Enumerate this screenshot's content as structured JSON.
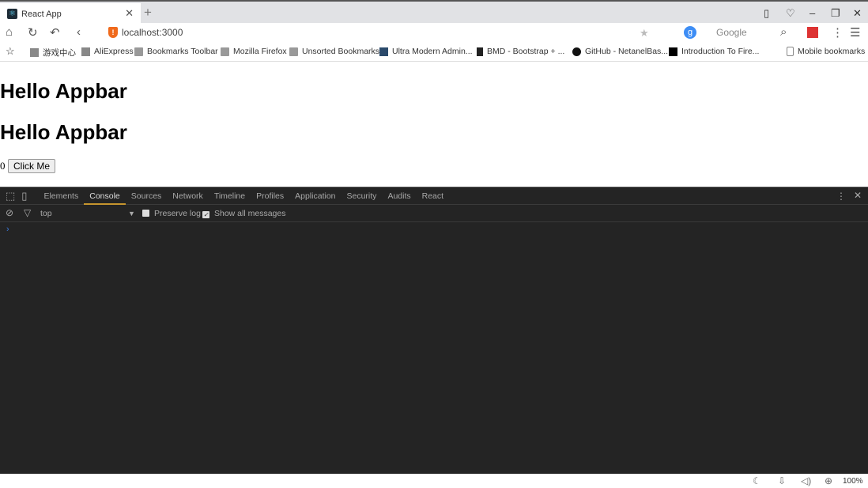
{
  "browser": {
    "tab_title": "React App",
    "url": "localhost:3000",
    "search_engine": "Google",
    "bookmarks": [
      {
        "label": "游戏中心",
        "icon": "page-icon"
      },
      {
        "label": "AliExpress",
        "icon": "page-icon"
      },
      {
        "label": "Bookmarks Toolbar",
        "icon": "folder-icon"
      },
      {
        "label": "Mozilla Firefox",
        "icon": "folder-icon"
      },
      {
        "label": "Unsorted Bookmarks",
        "icon": "folder-icon"
      },
      {
        "label": "Ultra Modern Admin...",
        "icon": "w3-icon"
      },
      {
        "label": "BMD - Bootstrap + ...",
        "icon": "bmd-icon"
      },
      {
        "label": "GitHub - NetanelBas...",
        "icon": "github-icon"
      },
      {
        "label": "Introduction To Fire...",
        "icon": "medium-icon"
      }
    ],
    "mobile_bookmarks": "Mobile bookmarks"
  },
  "page": {
    "heading1": "Hello Appbar",
    "heading2": "Hello Appbar",
    "count": "0",
    "button": "Click Me"
  },
  "devtools": {
    "tabs": [
      "Elements",
      "Console",
      "Sources",
      "Network",
      "Timeline",
      "Profiles",
      "Application",
      "Security",
      "Audits",
      "React"
    ],
    "active_tab": "Console",
    "context": "top",
    "preserve_log": "Preserve log",
    "show_all": "Show all messages",
    "prompt": "›"
  },
  "status": {
    "zoom": "100%"
  }
}
